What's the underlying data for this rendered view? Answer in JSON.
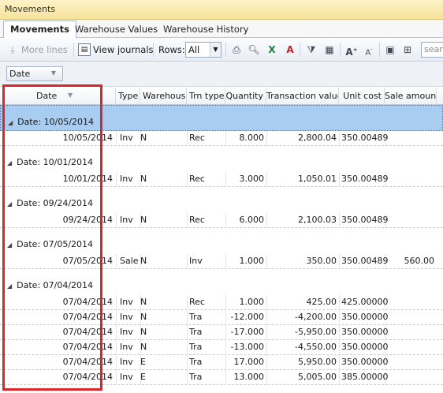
{
  "window": {
    "title": "Movements"
  },
  "tabs": [
    {
      "label": "Movements",
      "active": true
    },
    {
      "label": "Warehouse Values",
      "active": false
    },
    {
      "label": "Warehouse History",
      "active": false
    }
  ],
  "toolbar": {
    "more_lines": "More lines",
    "view_journals": "View journals",
    "rows_label": "Rows:",
    "rows_value": "All",
    "search_placeholder": "searc",
    "icons": [
      "print-icon",
      "print-preview-icon",
      "excel-export-icon",
      "pdf-export-icon",
      "filter-icon",
      "columns-icon",
      "font-increase-icon",
      "font-decrease-icon",
      "image-icon",
      "layout-icon"
    ]
  },
  "grouping": {
    "chip_label": "Date"
  },
  "columns": [
    "Date",
    "Type",
    "Warehouse",
    "Trn type",
    "Quantity",
    "Transaction value",
    "Unit cost",
    "Sale amount"
  ],
  "groups": [
    {
      "label": "Date: 10/05/2014",
      "selected": true,
      "rows": [
        [
          "10/05/2014",
          "Inv",
          "N",
          "Rec",
          "8.000",
          "2,800.04",
          "350.00489",
          ""
        ]
      ]
    },
    {
      "label": "Date: 10/01/2014",
      "selected": false,
      "rows": [
        [
          "10/01/2014",
          "Inv",
          "N",
          "Rec",
          "3.000",
          "1,050.01",
          "350.00489",
          ""
        ]
      ]
    },
    {
      "label": "Date: 09/24/2014",
      "selected": false,
      "rows": [
        [
          "09/24/2014",
          "Inv",
          "N",
          "Rec",
          "6.000",
          "2,100.03",
          "350.00489",
          ""
        ]
      ]
    },
    {
      "label": "Date: 07/05/2014",
      "selected": false,
      "rows": [
        [
          "07/05/2014",
          "Sale",
          "N",
          "Inv",
          "1.000",
          "350.00",
          "350.00489",
          "560.00"
        ]
      ]
    },
    {
      "label": "Date: 07/04/2014",
      "selected": false,
      "rows": [
        [
          "07/04/2014",
          "Inv",
          "N",
          "Rec",
          "1.000",
          "425.00",
          "425.00000",
          ""
        ],
        [
          "07/04/2014",
          "Inv",
          "N",
          "Tra",
          "-12.000",
          "-4,200.00",
          "350.00000",
          ""
        ],
        [
          "07/04/2014",
          "Inv",
          "N",
          "Tra",
          "-17.000",
          "-5,950.00",
          "350.00000",
          ""
        ],
        [
          "07/04/2014",
          "Inv",
          "N",
          "Tra",
          "-13.000",
          "-4,550.00",
          "350.00000",
          ""
        ],
        [
          "07/04/2014",
          "Inv",
          "E",
          "Tra",
          "17.000",
          "5,950.00",
          "350.00000",
          ""
        ],
        [
          "07/04/2014",
          "Inv",
          "E",
          "Tra",
          "13.000",
          "5,005.00",
          "385.00000",
          ""
        ]
      ]
    }
  ],
  "colors": {
    "highlight_border": "#d9262a",
    "selected_group": "#a8cdf0",
    "titlebar": "#f5e29a"
  }
}
